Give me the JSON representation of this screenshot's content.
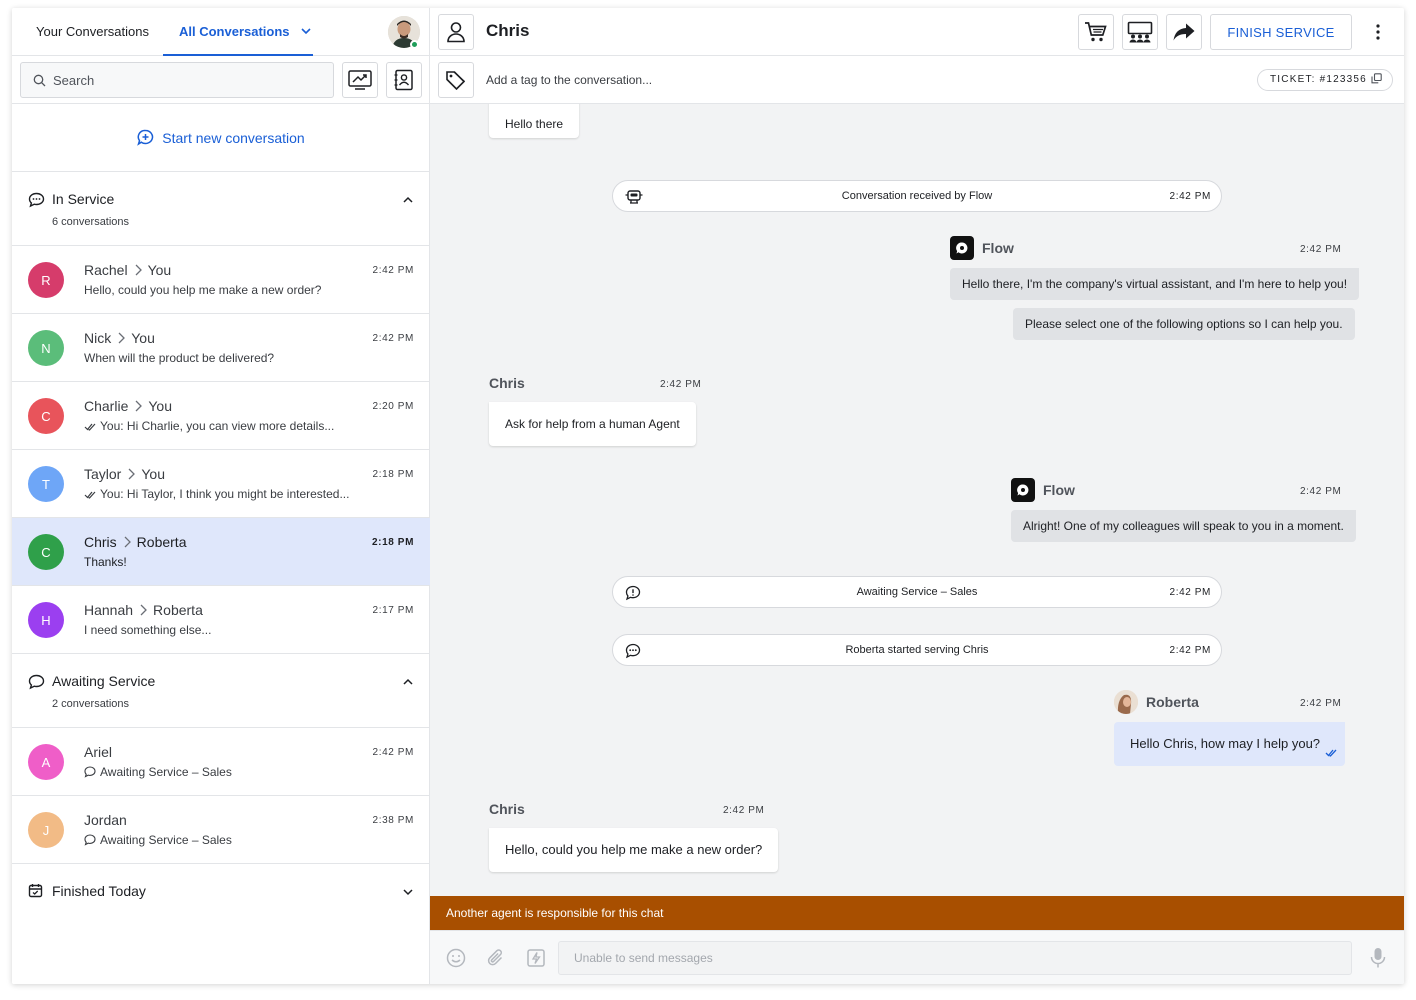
{
  "tabs": {
    "yours": "Your Conversations",
    "all": "All Conversations"
  },
  "search": {
    "placeholder": "Search"
  },
  "start_new": "Start new conversation",
  "sections": {
    "in_service": {
      "title": "In Service",
      "count": "6 conversations"
    },
    "awaiting": {
      "title": "Awaiting Service",
      "count": "2 conversations"
    },
    "finished": {
      "title": "Finished Today"
    }
  },
  "in_service": [
    {
      "initial": "R",
      "color": "#d63c6b",
      "from": "Rachel",
      "to": "You",
      "time": "2:42 PM",
      "preview": "Hello, could you help me make a new order?"
    },
    {
      "initial": "N",
      "color": "#5bbd7a",
      "from": "Nick",
      "to": "You",
      "time": "2:42 PM",
      "preview": "When will the product be delivered?"
    },
    {
      "initial": "C",
      "color": "#e8545b",
      "from": "Charlie",
      "to": "You",
      "time": "2:20 PM",
      "preview": "You: Hi Charlie, you can view more details..."
    },
    {
      "initial": "T",
      "color": "#6ea6f7",
      "from": "Taylor",
      "to": "You",
      "time": "2:18 PM",
      "preview": "You: Hi Taylor, I think you might be interested..."
    },
    {
      "initial": "C",
      "color": "#2fa04a",
      "from": "Chris",
      "to": "Roberta",
      "time": "2:18 PM",
      "preview": "Thanks!"
    },
    {
      "initial": "H",
      "color": "#9b3ff0",
      "from": "Hannah",
      "to": "Roberta",
      "time": "2:17 PM",
      "preview": "I need something else..."
    }
  ],
  "awaiting": [
    {
      "initial": "A",
      "color": "#ef5ec8",
      "from": "Ariel",
      "time": "2:42 PM",
      "preview": "Awaiting Service – Sales"
    },
    {
      "initial": "J",
      "color": "#f2bb86",
      "from": "Jordan",
      "time": "2:38 PM",
      "preview": "Awaiting Service – Sales"
    }
  ],
  "header": {
    "contact_name": "Chris",
    "finish_label": "FINISH SERVICE"
  },
  "tag": {
    "placeholder": "Add a tag to the conversation..."
  },
  "ticket": "TICKET: #123356",
  "messages": {
    "m1": "Hello there",
    "sys1": {
      "text": "Conversation received by Flow",
      "time": "2:42 PM"
    },
    "flow1": {
      "sender": "Flow",
      "time": "2:42 PM",
      "text1": "Hello there, I'm the company's virtual assistant, and I'm here to help you!",
      "text2": "Please select one of the following options so I can help you."
    },
    "chris1": {
      "sender": "Chris",
      "time": "2:42 PM",
      "text": "Ask for help from a human Agent"
    },
    "flow2": {
      "sender": "Flow",
      "time": "2:42 PM",
      "text": "Alright! One of my colleagues will speak to you in a moment."
    },
    "sys2": {
      "text": "Awaiting Service – Sales",
      "time": "2:42 PM"
    },
    "sys3": {
      "text": "Roberta started serving Chris",
      "time": "2:42 PM"
    },
    "roberta1": {
      "sender": "Roberta",
      "time": "2:42 PM",
      "text": "Hello Chris, how may I help you?"
    },
    "chris2": {
      "sender": "Chris",
      "time": "2:42 PM",
      "text": "Hello, could you help me make a new order?"
    }
  },
  "alert": "Another agent is responsible for this chat",
  "composer": {
    "placeholder": "Unable to send messages"
  },
  "colors": {
    "accent": "#1a5fd6",
    "alert": "#a84f00",
    "online": "#1f9e5a",
    "active_row": "#dfe7fb"
  }
}
